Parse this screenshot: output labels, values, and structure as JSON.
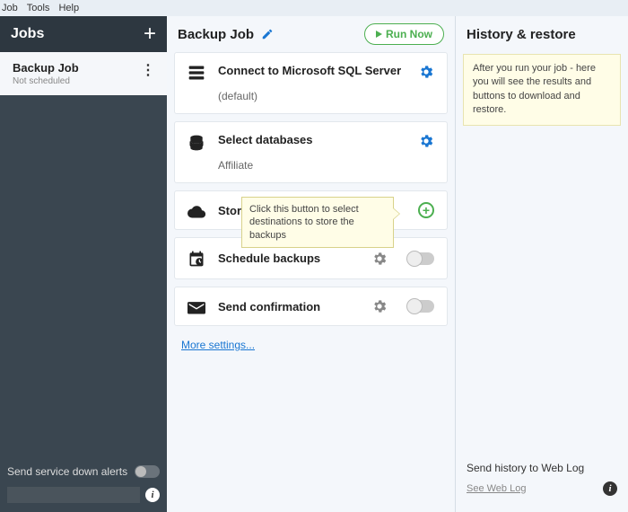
{
  "menu": {
    "job": "Job",
    "tools": "Tools",
    "help": "Help"
  },
  "left": {
    "title": "Jobs",
    "job": {
      "name": "Backup Job",
      "status": "Not scheduled"
    },
    "alerts_label": "Send service down alerts"
  },
  "center": {
    "title": "Backup Job",
    "run": "Run Now",
    "steps": {
      "connect": {
        "title": "Connect to Microsoft SQL Server",
        "sub": "(default)"
      },
      "select": {
        "title": "Select databases",
        "sub": "Affiliate"
      },
      "store": {
        "title": "Store backups in destinations",
        "tooltip": "Click this button to select destinations to store the backups"
      },
      "schedule": {
        "title": "Schedule backups"
      },
      "confirm": {
        "title": "Send confirmation"
      }
    },
    "more": "More settings..."
  },
  "right": {
    "title": "History & restore",
    "note": "After you run your job - here you will see the results and buttons to download and restore.",
    "send_label": "Send history to Web Log",
    "weblog": "See Web Log"
  }
}
